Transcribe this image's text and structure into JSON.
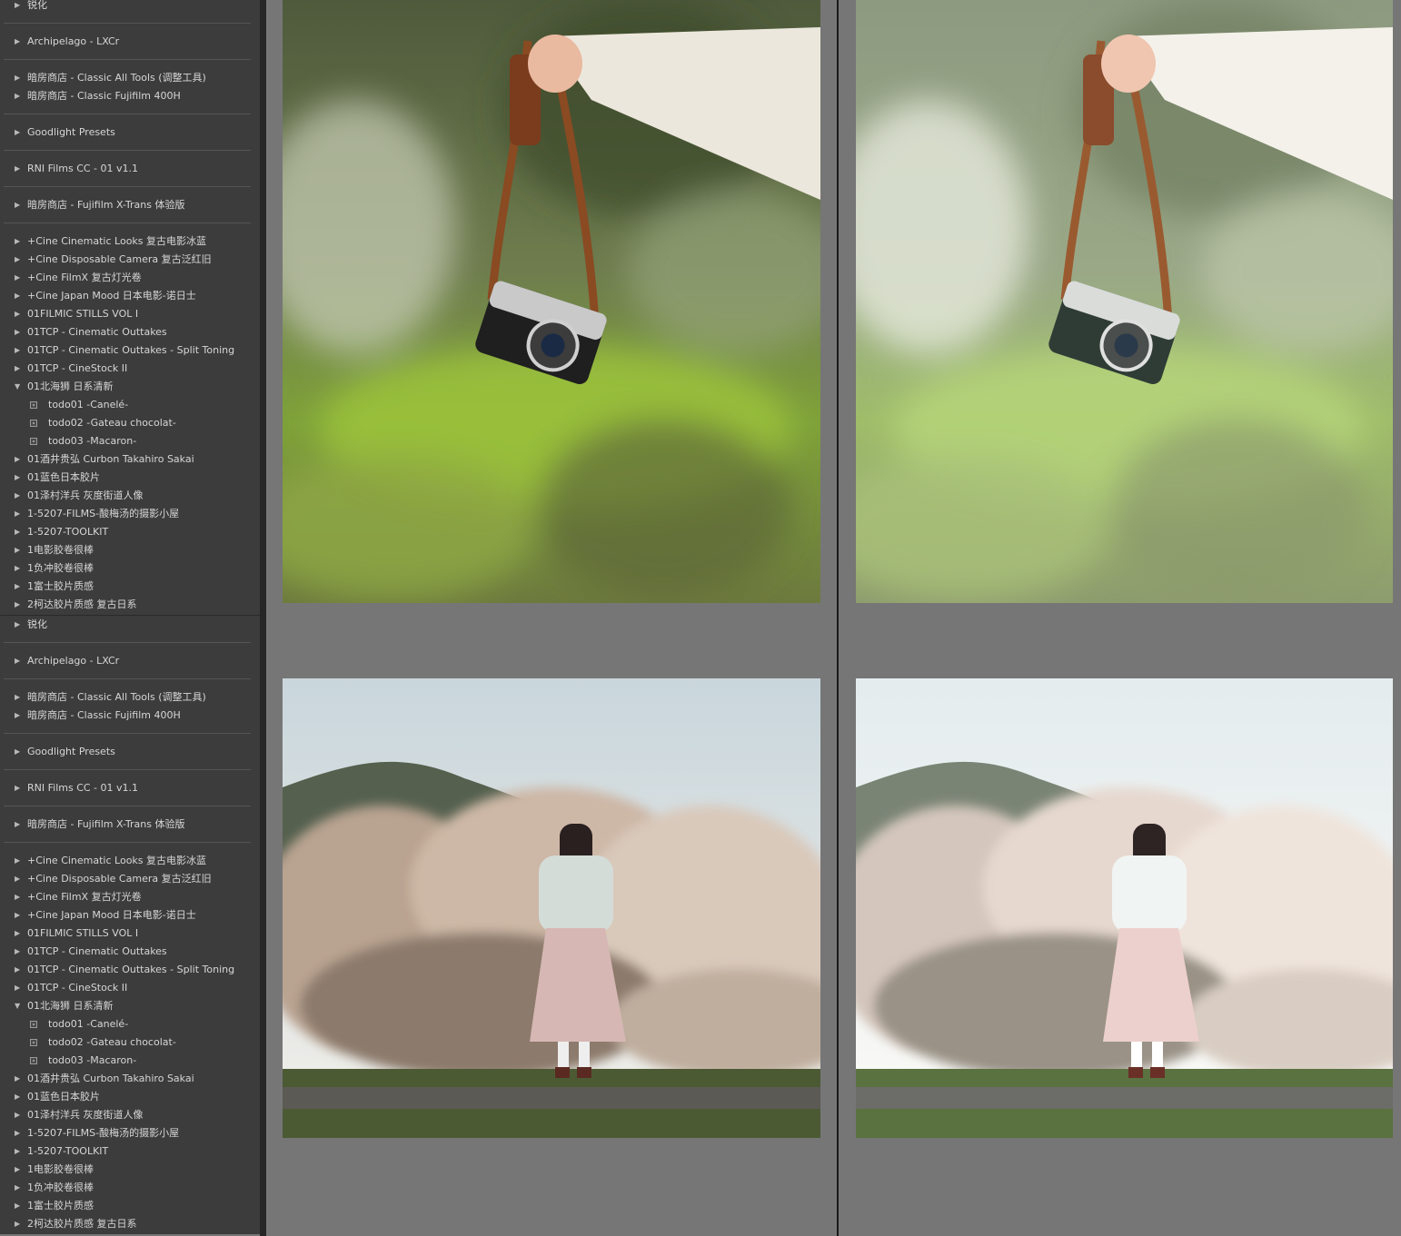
{
  "presets": [
    {
      "type": "folder",
      "label": "锐化"
    },
    {
      "type": "sep"
    },
    {
      "type": "folder",
      "label": "Archipelago - LXCr"
    },
    {
      "type": "sep"
    },
    {
      "type": "folder",
      "label": "暗房商店 - Classic All Tools (调整工具)"
    },
    {
      "type": "folder",
      "label": "暗房商店 - Classic Fujifilm 400H"
    },
    {
      "type": "sep"
    },
    {
      "type": "folder",
      "label": "Goodlight Presets"
    },
    {
      "type": "sep"
    },
    {
      "type": "folder",
      "label": "RNI Films CC - 01 v1.1"
    },
    {
      "type": "sep"
    },
    {
      "type": "folder",
      "label": "暗房商店 - Fujifilm X-Trans 体验版"
    },
    {
      "type": "sep"
    },
    {
      "type": "folder",
      "label": "+Cine Cinematic Looks 复古电影冰蓝"
    },
    {
      "type": "folder",
      "label": "+Cine Disposable Camera 复古泛红旧"
    },
    {
      "type": "folder",
      "label": "+Cine FilmX  复古灯光卷"
    },
    {
      "type": "folder",
      "label": "+Cine Japan Mood 日本电影-诺日士"
    },
    {
      "type": "folder",
      "label": "01FILMIC STILLS VOL I"
    },
    {
      "type": "folder",
      "label": "01TCP - Cinematic Outtakes"
    },
    {
      "type": "folder",
      "label": "01TCP - Cinematic Outtakes - Split Toning"
    },
    {
      "type": "folder",
      "label": "01TCP - CineStock II"
    },
    {
      "type": "open",
      "label": "01北海狮 日系清新"
    },
    {
      "type": "child",
      "label": "todo01 -Canelé-"
    },
    {
      "type": "child",
      "label": "todo02 -Gateau chocolat-"
    },
    {
      "type": "child",
      "label": "todo03 -Macaron-"
    },
    {
      "type": "folder",
      "label": "01酒井贵弘 Curbon Takahiro Sakai"
    },
    {
      "type": "folder",
      "label": "01蓝色日本胶片"
    },
    {
      "type": "folder",
      "label": "01泽村洋兵 灰度街道人像"
    },
    {
      "type": "folder",
      "label": "1-5207-FILMS-酸梅汤的摄影小屋"
    },
    {
      "type": "folder",
      "label": "1-5207-TOOLKIT"
    },
    {
      "type": "folder",
      "label": "1电影胶卷很棒"
    },
    {
      "type": "folder",
      "label": "1负冲胶卷很棒"
    },
    {
      "type": "folder",
      "label": "1富士胶片质感"
    },
    {
      "type": "folder",
      "label": "2柯达胶片质感 复古日系"
    }
  ],
  "icons": {
    "collapsed": "▶",
    "expanded": "▼"
  },
  "colors": {
    "panel_bg": "#3c3c3c",
    "canvas_bg": "#767676",
    "text": "#d6d6d6"
  }
}
